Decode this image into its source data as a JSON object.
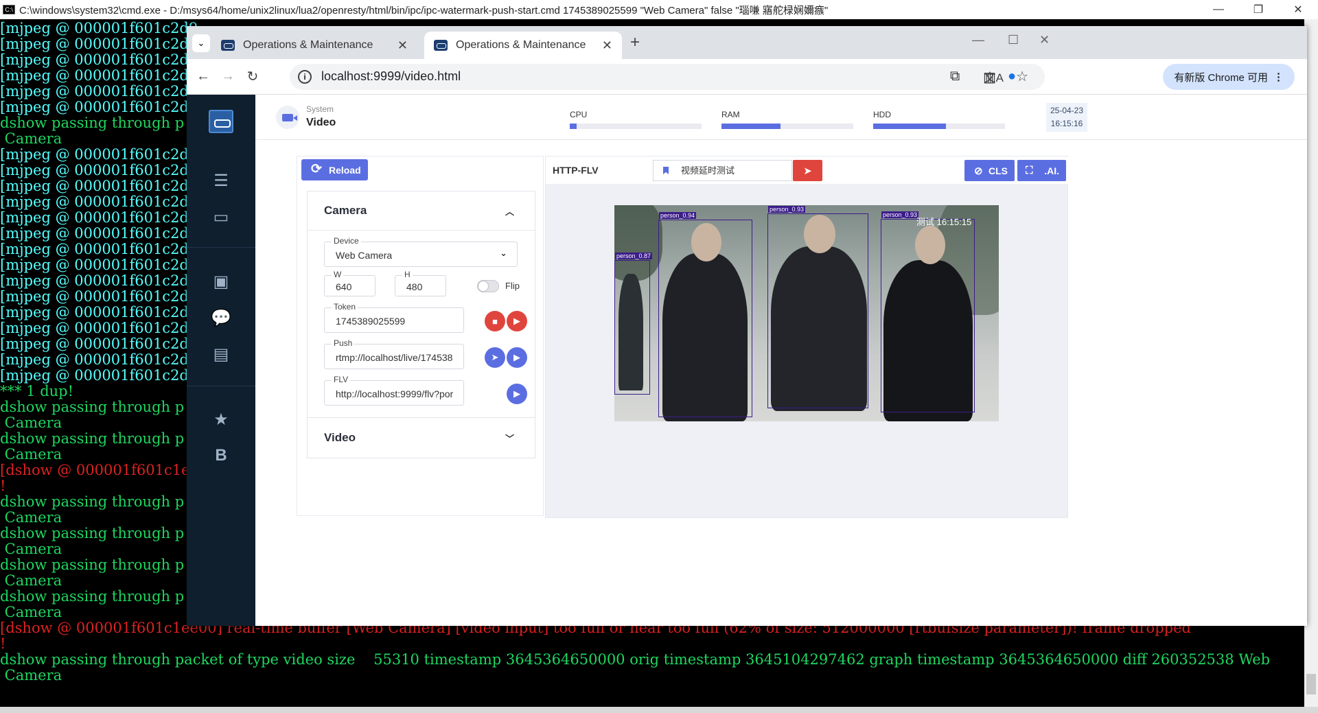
{
  "cmd": {
    "title": "C:\\windows\\system32\\cmd.exe - D:/msys64/home/unix2linux/lua2/openresty/html/bin/ipc/ipc-watermark-push-start.cmd   1745389025599 \"Web Camera\" false \"瑙嗛   寤舵椂娴嬭瘯\"",
    "lines": [
      {
        "text": "[mjpeg @ 000001f601c2d9",
        "color": "c-cyan"
      },
      {
        "text": "[mjpeg @ 000001f601c2d9",
        "color": "c-cyan"
      },
      {
        "text": "[mjpeg @ 000001f601c2d9",
        "color": "c-cyan"
      },
      {
        "text": "[mjpeg @ 000001f601c2d9",
        "color": "c-cyan"
      },
      {
        "text": "[mjpeg @ 000001f601c2d9",
        "color": "c-cyan"
      },
      {
        "text": "[mjpeg @ 000001f601c2d9",
        "color": "c-cyan"
      },
      {
        "text": "dshow passing through p",
        "color": "c-green"
      },
      {
        "text": " Camera",
        "color": "c-green"
      },
      {
        "text": "[mjpeg @ 000001f601c2d9",
        "color": "c-cyan"
      },
      {
        "text": "[mjpeg @ 000001f601c2d9",
        "color": "c-cyan"
      },
      {
        "text": "[mjpeg @ 000001f601c2d9",
        "color": "c-cyan"
      },
      {
        "text": "[mjpeg @ 000001f601c2d9",
        "color": "c-cyan"
      },
      {
        "text": "[mjpeg @ 000001f601c2d9",
        "color": "c-cyan"
      },
      {
        "text": "[mjpeg @ 000001f601c2d9",
        "color": "c-cyan"
      },
      {
        "text": "[mjpeg @ 000001f601c2d9",
        "color": "c-cyan"
      },
      {
        "text": "[mjpeg @ 000001f601c2d9",
        "color": "c-cyan"
      },
      {
        "text": "[mjpeg @ 000001f601c2d9",
        "color": "c-cyan"
      },
      {
        "text": "[mjpeg @ 000001f601c2d9",
        "color": "c-cyan"
      },
      {
        "text": "[mjpeg @ 000001f601c2d9",
        "color": "c-cyan"
      },
      {
        "text": "[mjpeg @ 000001f601c2d9",
        "color": "c-cyan"
      },
      {
        "text": "[mjpeg @ 000001f601c2d9",
        "color": "c-cyan"
      },
      {
        "text": "[mjpeg @ 000001f601c2d9",
        "color": "c-cyan"
      },
      {
        "text": "[mjpeg @ 000001f601c2d9",
        "color": "c-cyan"
      },
      {
        "text": "*** 1 dup!",
        "color": "c-green"
      },
      {
        "text": "dshow passing through p",
        "color": "c-green"
      },
      {
        "text": " Camera",
        "color": "c-green"
      },
      {
        "text": "dshow passing through p",
        "color": "c-green"
      },
      {
        "text": " Camera",
        "color": "c-green"
      },
      {
        "text": "[dshow @ 000001f601c1ee",
        "color": "c-red"
      },
      {
        "text": "!",
        "color": "c-red"
      },
      {
        "text": "dshow passing through p",
        "color": "c-green"
      },
      {
        "text": " Camera",
        "color": "c-green"
      },
      {
        "text": "dshow passing through p",
        "color": "c-green"
      },
      {
        "text": " Camera",
        "color": "c-green"
      },
      {
        "text": "dshow passing through p",
        "color": "c-green"
      },
      {
        "text": " Camera",
        "color": "c-green"
      },
      {
        "text": "dshow passing through p",
        "color": "c-green"
      },
      {
        "text": " Camera",
        "color": "c-green"
      },
      {
        "text": "[dshow @ 000001f601c1ee00] real-time buffer [Web Camera] [video input] too full or near too full (62% of size: 512000000 [rtbufsize parameter])! frame dropped",
        "color": "c-red"
      },
      {
        "text": "!",
        "color": "c-red"
      },
      {
        "text": "dshow passing through packet of type video size    55310 timestamp 3645364650000 orig timestamp 3645104297462 graph timestamp 3645364650000 diff 260352538 Web",
        "color": "c-green"
      },
      {
        "text": " Camera",
        "color": "c-green"
      },
      {
        "text": "",
        "color": "c-white"
      },
      {
        "text": "_",
        "color": "c-white"
      }
    ]
  },
  "browser": {
    "tabs": [
      {
        "title": "Operations & Maintenance"
      },
      {
        "title": "Operations & Maintenance"
      }
    ],
    "url": "localhost:9999/video.html",
    "update_label": "有新版 Chrome 可用"
  },
  "app": {
    "header": {
      "section": "System",
      "title": "Video",
      "meters": [
        {
          "label": "CPU",
          "value": 0.05
        },
        {
          "label": "RAM",
          "value": 0.45
        },
        {
          "label": "HDD",
          "value": 0.55
        }
      ],
      "date": "25-04-23",
      "time": "16:15:16"
    },
    "reload_label": "Reload",
    "camera_section": "Camera",
    "video_section": "Video",
    "device": {
      "label": "Device",
      "value": "Web Camera"
    },
    "width": {
      "label": "W",
      "value": "640"
    },
    "height": {
      "label": "H",
      "value": "480"
    },
    "flip_label": "Flip",
    "token": {
      "label": "Token",
      "value": "1745389025599"
    },
    "push": {
      "label": "Push",
      "value": "rtmp://localhost/live/174538"
    },
    "flv": {
      "label": "FLV",
      "value": "http://localhost:9999/flv?por"
    },
    "player": {
      "protocol": "HTTP-FLV",
      "watermark_input": "视频延时测试",
      "cls_label": "CLS",
      "ai_label": ".AI."
    },
    "video_overlay": {
      "watermark": "测试 16:15:15",
      "detections": [
        {
          "label": "person_0.87"
        },
        {
          "label": "person_0.94"
        },
        {
          "label": "person_0.93"
        },
        {
          "label": "person_0.93"
        }
      ]
    }
  }
}
